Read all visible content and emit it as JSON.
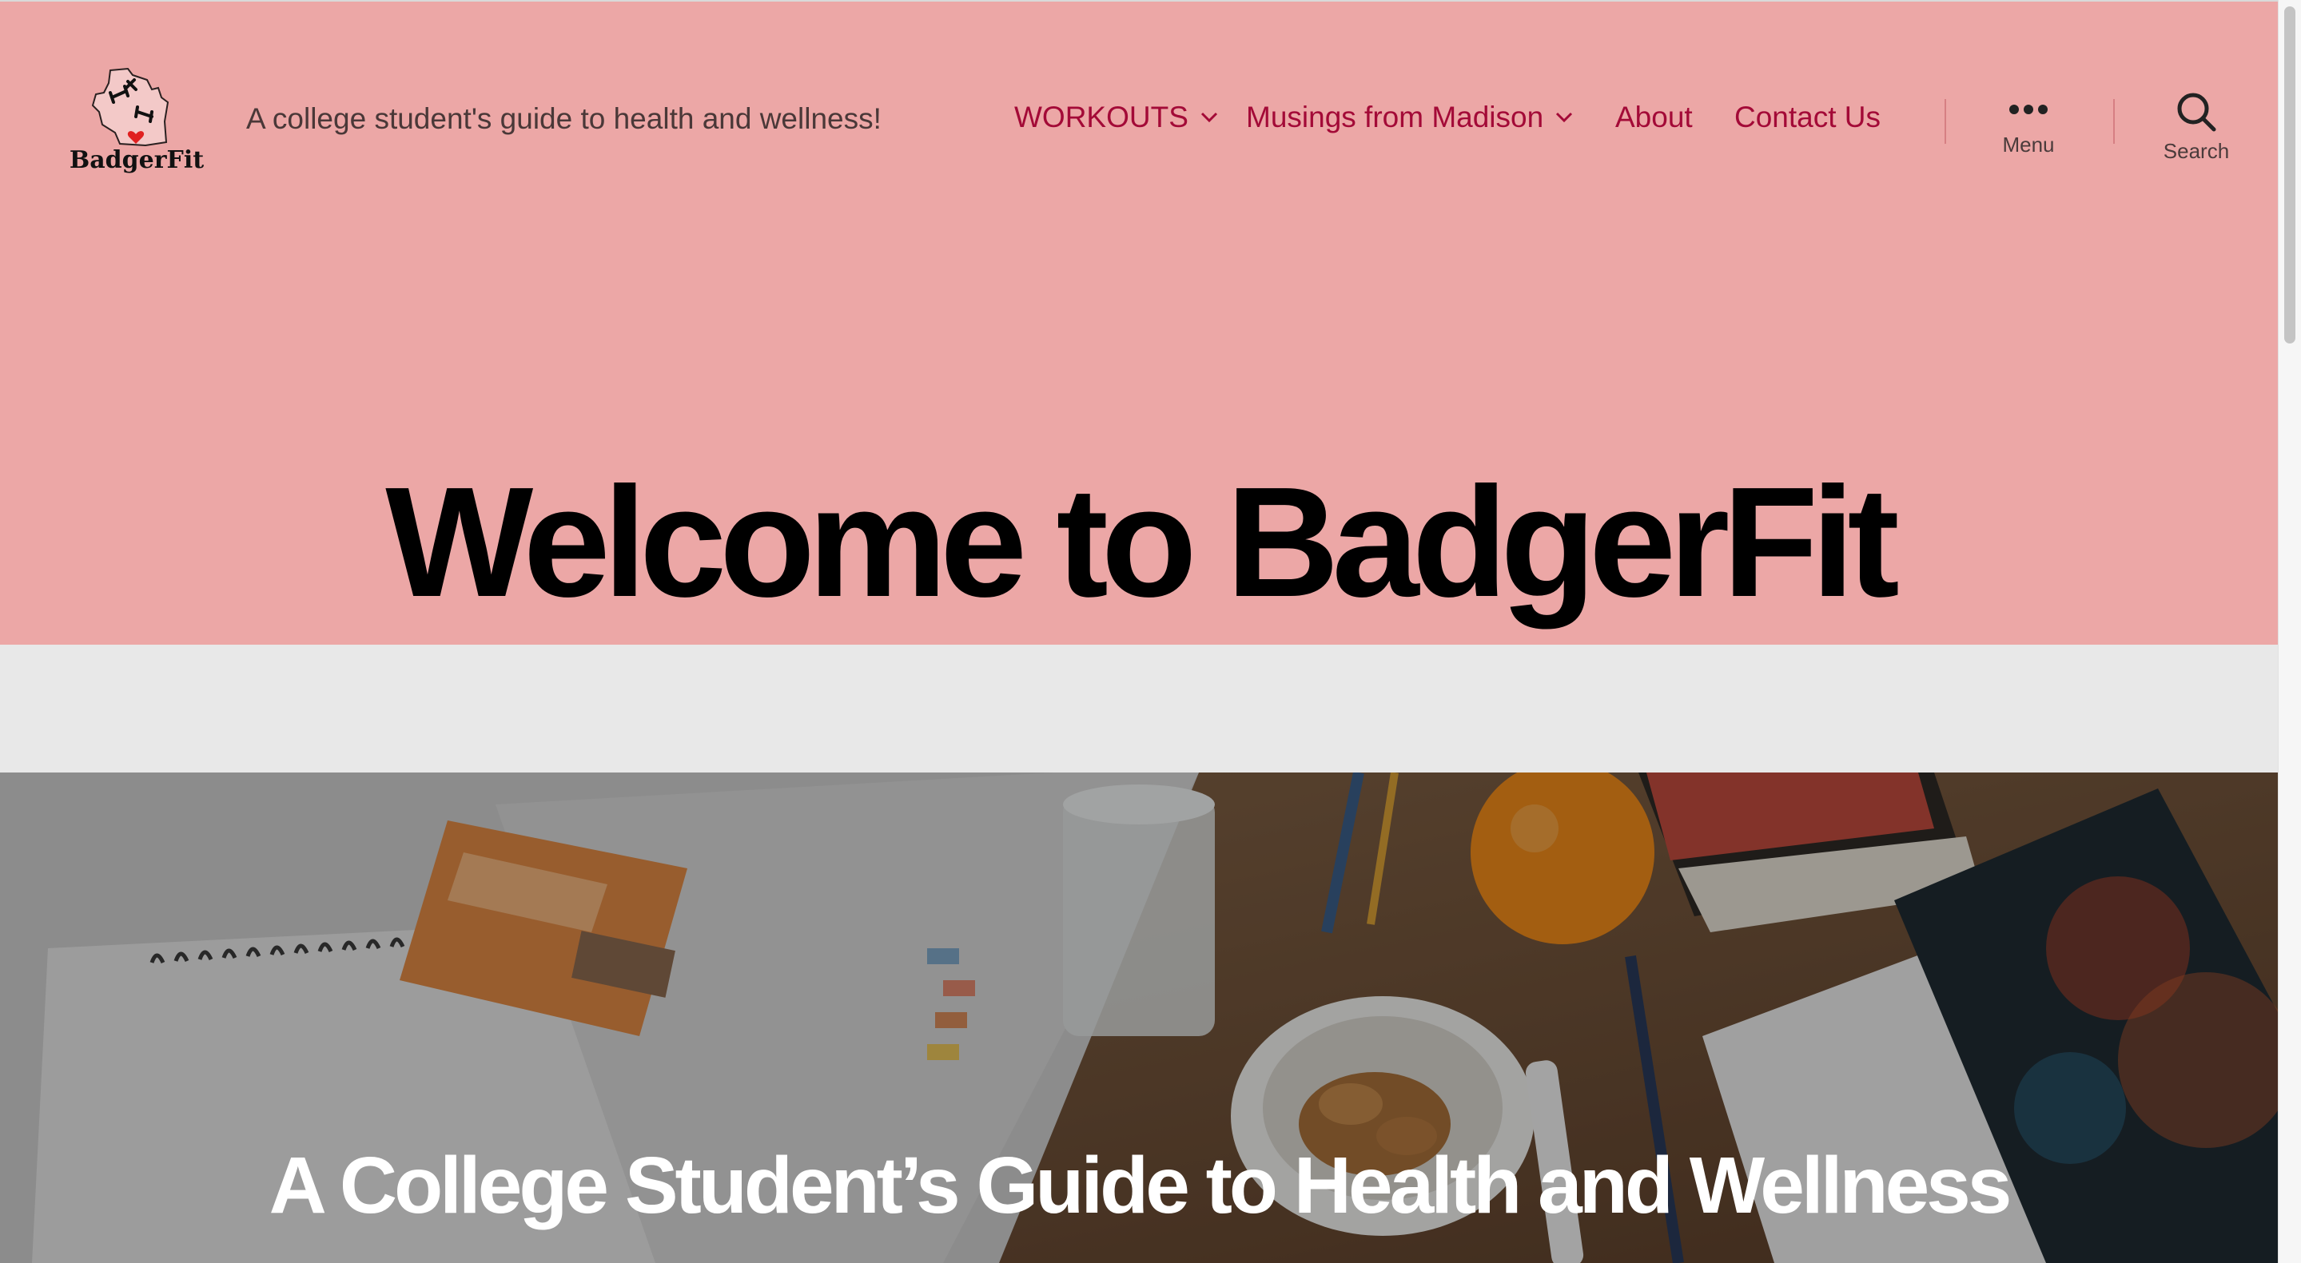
{
  "site": {
    "logo_text": "BadgerFit",
    "tagline": "A college student's guide to health and wellness!"
  },
  "nav": {
    "items": [
      {
        "label": "WORKOUTS",
        "has_submenu": true
      },
      {
        "label": "Musings from Madison",
        "has_submenu": true
      },
      {
        "label": "About",
        "has_submenu": false
      },
      {
        "label": "Contact Us",
        "has_submenu": false
      }
    ]
  },
  "toggles": {
    "menu_label": "Menu",
    "menu_icon": "ellipsis-icon",
    "search_label": "Search",
    "search_icon": "search-icon"
  },
  "hero": {
    "title": "Welcome to BadgerFit"
  },
  "cover": {
    "title": "A College Student’s Guide to Health and Wellness"
  },
  "colors": {
    "header_bg": "#eca7a6",
    "accent": "#a30a37",
    "separator_bg": "#e8e8e8"
  }
}
